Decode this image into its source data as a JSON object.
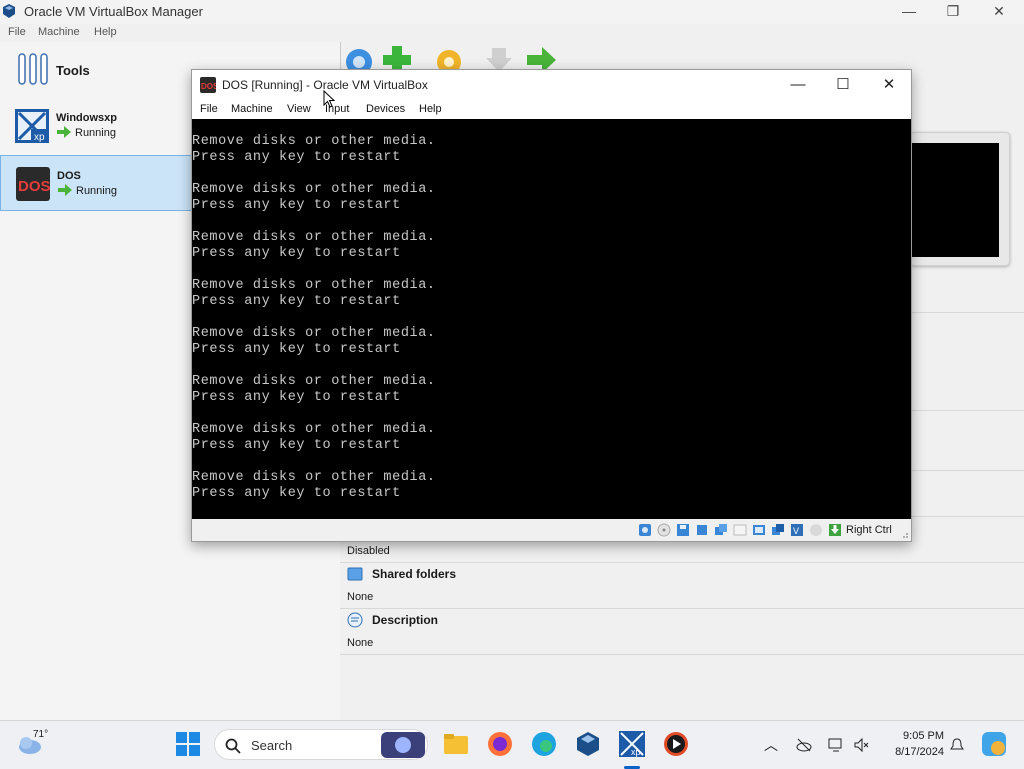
{
  "manager": {
    "title": "Oracle VM VirtualBox Manager",
    "menu": [
      "File",
      "Machine",
      "Help"
    ],
    "window_controls": {
      "minimize": "—",
      "maximize": "❐",
      "close": "✕"
    },
    "tools_label": "Tools",
    "vms": [
      {
        "name": "Windowsxp",
        "state": "Running",
        "selected": false
      },
      {
        "name": "DOS",
        "state": "Running",
        "selected": true
      }
    ],
    "details": {
      "usb_value": "Disabled",
      "shared_folders": {
        "title": "Shared folders",
        "value": "None"
      },
      "description": {
        "title": "Description",
        "value": "None"
      }
    }
  },
  "vm_window": {
    "title": "DOS [Running] - Oracle VM VirtualBox",
    "menu": [
      "File",
      "Machine",
      "View",
      "Input",
      "Devices",
      "Help"
    ],
    "controls": {
      "minimize": "—",
      "maximize": "☐",
      "close": "✕"
    },
    "screen_lines": [
      "Remove disks or other media.",
      "Press any key to restart",
      "Remove disks or other media.",
      "Press any key to restart",
      "Remove disks or other media.",
      "Press any key to restart",
      "Remove disks or other media.",
      "Press any key to restart",
      "Remove disks or other media.",
      "Press any key to restart",
      "Remove disks or other media.",
      "Press any key to restart",
      "Remove disks or other media.",
      "Press any key to restart",
      "Remove disks or other media.",
      "Press any key to restart"
    ],
    "host_key": "Right Ctrl",
    "status_icons": [
      "hard-disk-icon",
      "optical-drive-icon",
      "floppy-icon",
      "audio-icon",
      "network-icon",
      "usb-icon",
      "shared-folder-icon",
      "display-icon",
      "recording-icon",
      "cpu-icon",
      "mouse-integration-icon",
      "keyboard-icon"
    ]
  },
  "taskbar": {
    "weather_temp": "71°",
    "search_placeholder": "Search",
    "time": "9:05 PM",
    "date": "8/17/2024",
    "pinned": [
      "start-icon",
      "search-icon",
      "file-explorer-icon",
      "firefox-icon",
      "edge-icon",
      "virtualbox-icon",
      "windowsxp-vm-icon",
      "media-player-icon"
    ],
    "colors": {
      "accent": "#0a64c8",
      "vb_blue": "#1c6bbf",
      "selection": "#cce4f7"
    }
  }
}
